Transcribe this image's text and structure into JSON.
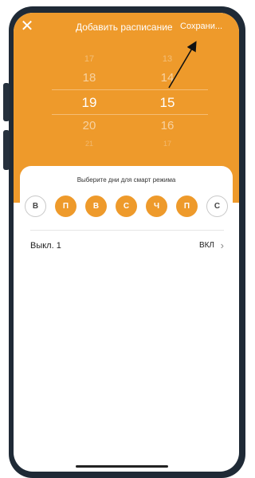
{
  "header": {
    "close_icon": "close-icon",
    "title": "Добавить расписание",
    "save_label": "Сохрани..."
  },
  "picker": {
    "hours": [
      "17",
      "18",
      "19",
      "20",
      "21"
    ],
    "minutes": [
      "13",
      "14",
      "15",
      "16",
      "17"
    ],
    "selected_hour": "19",
    "selected_minute": "15"
  },
  "sheet": {
    "title": "Выберите дни для смарт режима",
    "days": [
      {
        "label": "В",
        "selected": false
      },
      {
        "label": "П",
        "selected": true
      },
      {
        "label": "В",
        "selected": true
      },
      {
        "label": "С",
        "selected": true
      },
      {
        "label": "Ч",
        "selected": true
      },
      {
        "label": "П",
        "selected": true
      },
      {
        "label": "С",
        "selected": false
      }
    ],
    "row": {
      "label": "Выкл. 1",
      "value": "ВКЛ",
      "chevron": "chevron-right-icon"
    }
  },
  "colors": {
    "accent": "#ee9a2b",
    "frame": "#1f2a36"
  }
}
